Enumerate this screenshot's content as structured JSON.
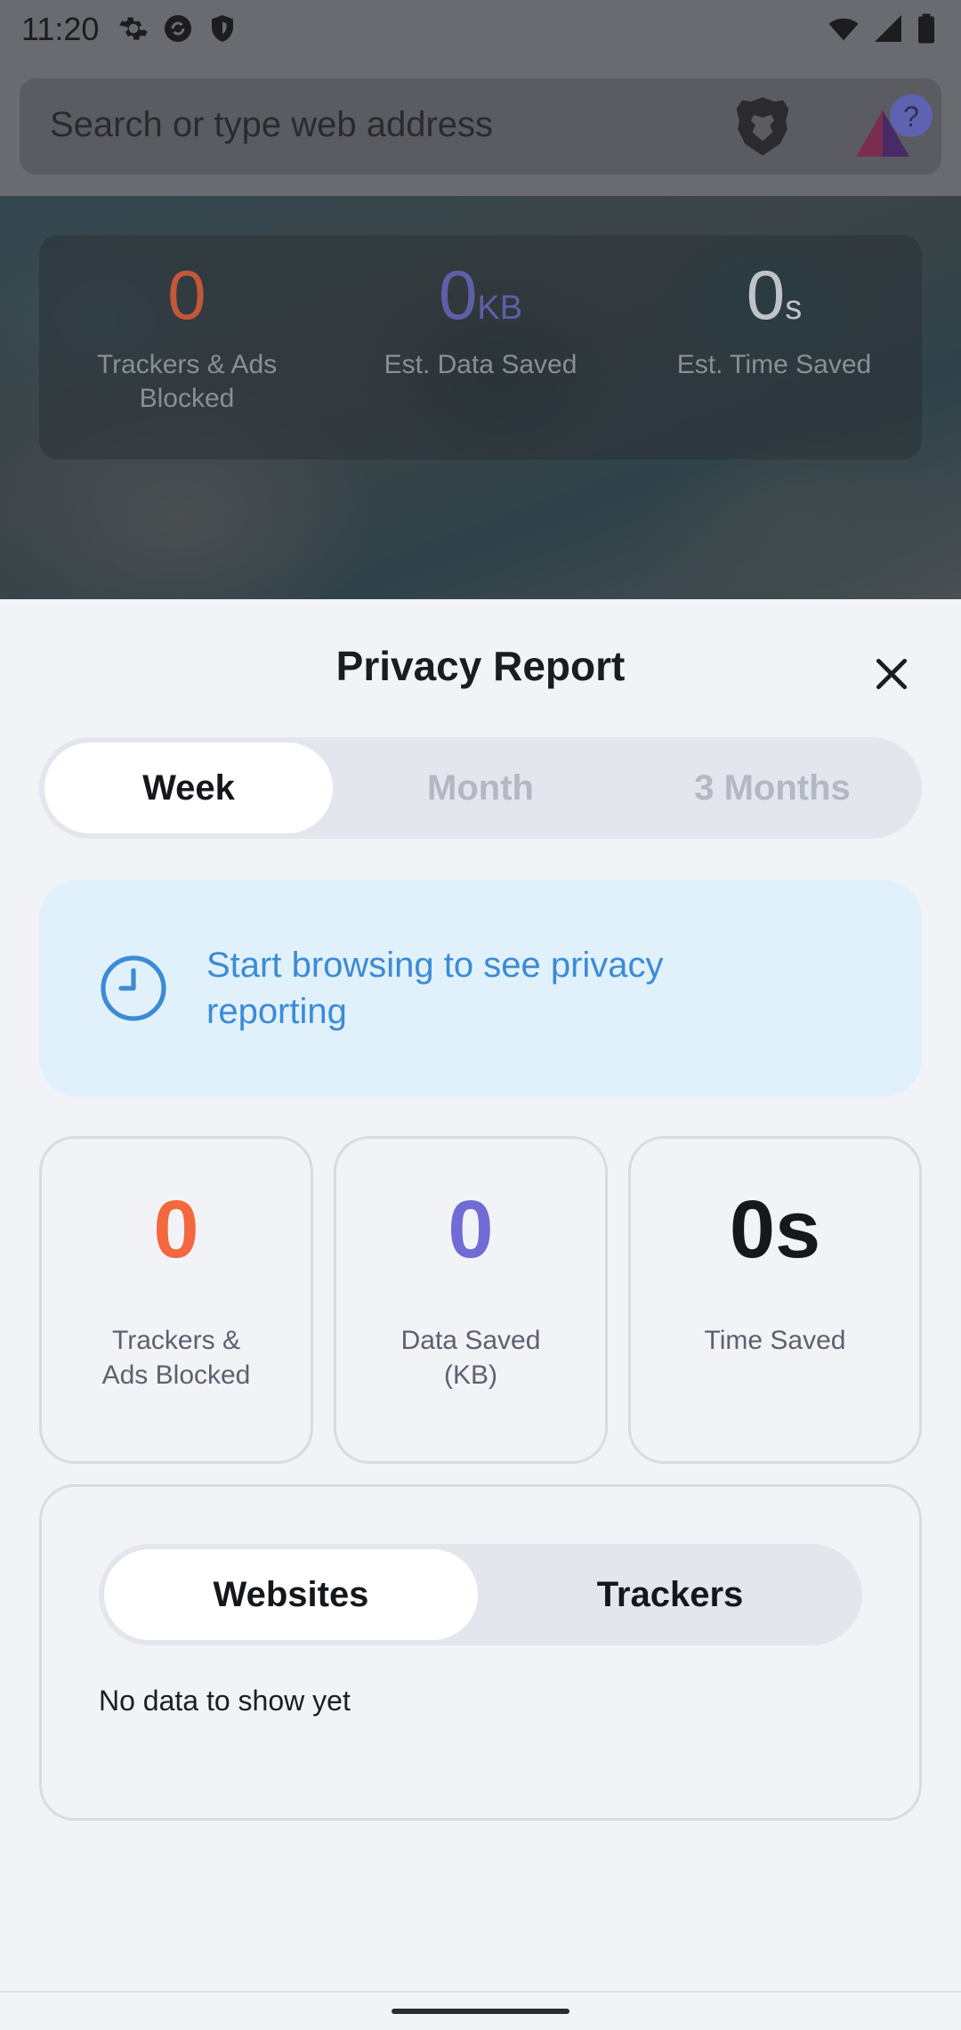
{
  "status_bar": {
    "time": "11:20",
    "left_icons": [
      "settings-icon",
      "sync-icon",
      "shield-icon"
    ],
    "right_icons": [
      "wifi-icon",
      "signal-icon",
      "battery-icon"
    ]
  },
  "browser": {
    "search_placeholder": "Search or type web address",
    "brave_shields_icon": "brave-lion-icon",
    "rewards_icon": "brave-rewards-icon",
    "rewards_badge": "?"
  },
  "background_stats": [
    {
      "value": "0",
      "unit": "",
      "label": "Trackers & Ads Blocked",
      "color": "#c2573a"
    },
    {
      "value": "0",
      "unit": "KB",
      "label": "Est. Data Saved",
      "color": "#5d5fa8"
    },
    {
      "value": "0",
      "unit": "s",
      "label": "Est. Time Saved",
      "color": "#bfc3c7"
    }
  ],
  "sheet": {
    "title": "Privacy Report",
    "close_icon": "close-icon",
    "period_tabs": [
      {
        "label": "Week",
        "active": true
      },
      {
        "label": "Month",
        "active": false
      },
      {
        "label": "3 Months",
        "active": false
      }
    ],
    "info": {
      "icon": "clock-icon",
      "text": "Start browsing to see privacy reporting"
    },
    "stats": [
      {
        "value": "0",
        "label": "Trackers & Ads Blocked",
        "color": "#f4683f"
      },
      {
        "value": "0",
        "label": "Data Saved (KB)",
        "color": "#6f6cd6"
      },
      {
        "value": "0s",
        "label": "Time Saved",
        "color": "#17181d"
      }
    ],
    "list_tabs": [
      {
        "label": "Websites",
        "active": true
      },
      {
        "label": "Trackers",
        "active": false
      }
    ],
    "empty_message": "No data to show yet"
  },
  "colors": {
    "accent_blue": "#3b8bd6",
    "info_bg": "#e1f1fc",
    "sheet_bg": "#f2f3f6"
  }
}
